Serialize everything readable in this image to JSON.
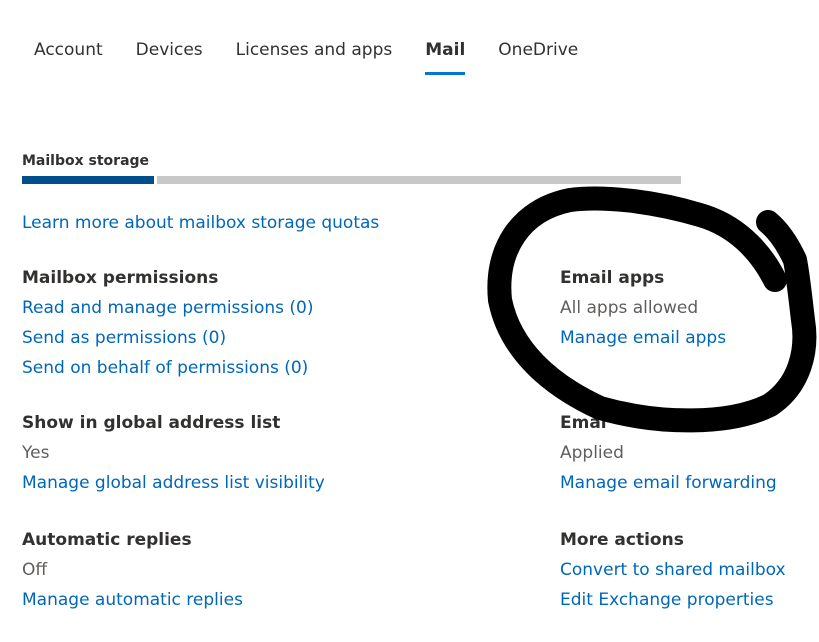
{
  "tabs": [
    {
      "label": "Account",
      "active": false
    },
    {
      "label": "Devices",
      "active": false
    },
    {
      "label": "Licenses and apps",
      "active": false
    },
    {
      "label": "Mail",
      "active": true
    },
    {
      "label": "OneDrive",
      "active": false
    }
  ],
  "storage": {
    "label": "Mailbox storage",
    "used_fraction": 0.2,
    "used_color": "#004e8c",
    "free_color": "#c8c8c8"
  },
  "learn_more": "Learn more about mailbox storage quotas",
  "left_column": {
    "permissions": {
      "heading": "Mailbox permissions",
      "links": [
        "Read and manage permissions (0)",
        "Send as permissions (0)",
        "Send on behalf of permissions (0)"
      ]
    },
    "gal": {
      "heading": "Show in global address list",
      "value": "Yes",
      "link": "Manage global address list visibility"
    },
    "auto_replies": {
      "heading": "Automatic replies",
      "value": "Off",
      "link": "Manage automatic replies"
    }
  },
  "right_column": {
    "email_apps": {
      "heading": "Email apps",
      "value": "All apps allowed",
      "link": "Manage email apps"
    },
    "forwarding": {
      "heading": "Emai",
      "value": "Applied",
      "link": "Manage email forwarding"
    },
    "more_actions": {
      "heading": "More actions",
      "links": [
        "Convert to shared mailbox",
        "Edit Exchange properties"
      ]
    }
  },
  "colors": {
    "accent": "#0078d4",
    "link": "#0067b8",
    "scribble": "#000000"
  }
}
